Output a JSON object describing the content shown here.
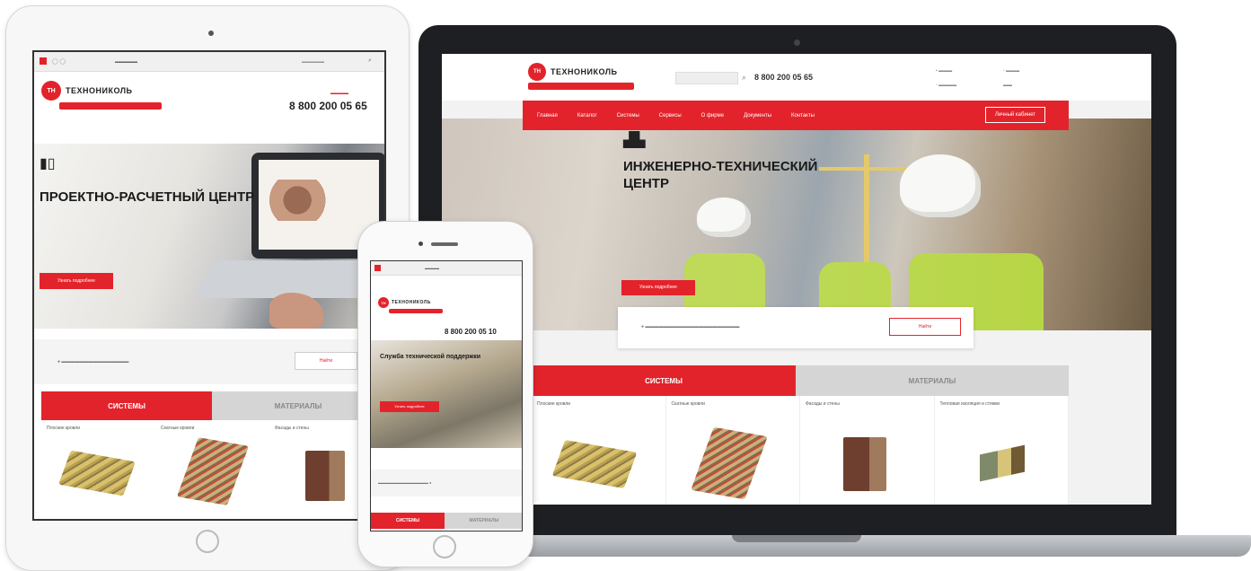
{
  "brand": {
    "name": "ТЕХНОНИКОЛЬ",
    "logo_mark": "ТН",
    "accent_color": "#e3232b"
  },
  "laptop": {
    "phone_number": "8 800 200 05 65",
    "nav": [
      "Главная",
      "Каталог",
      "Системы",
      "Сервисы",
      "О фирме",
      "Документы",
      "Контакты"
    ],
    "nav_cta": "Личный кабинет",
    "hero_icon": "engineering-icon",
    "hero_title": "ИНЖЕНЕРНО-ТЕХНИЧЕСКИЙ ЦЕНТР",
    "hero_button": "Узнать подробнее",
    "filter_button": "Найти",
    "tabs": {
      "active": "СИСТЕМЫ",
      "inactive": "МАТЕРИАЛЫ"
    },
    "cards": [
      {
        "label": "Плоские кровли"
      },
      {
        "label": "Скатные кровли"
      },
      {
        "label": "Фасады и стены"
      },
      {
        "label": "Тепловая изоляция и стяжки"
      }
    ]
  },
  "tablet": {
    "phone_number": "8 800 200 05 65",
    "hero_icon": "calculator-icon",
    "hero_title": "ПРОЕКТНО-РАСЧЕТНЫЙ ЦЕНТР",
    "hero_button": "Узнать подробнее",
    "filter_button": "Найти",
    "tabs": {
      "active": "СИСТЕМЫ",
      "inactive": "МАТЕРИАЛЫ"
    },
    "cards": [
      {
        "label": "Плоские кровли"
      },
      {
        "label": "Скатные кровли"
      },
      {
        "label": "Фасады и стены"
      }
    ]
  },
  "phone": {
    "phone_number": "8 800 200 05 10",
    "hero_title": "Служба технической поддержки",
    "hero_button": "Узнать подробнее",
    "tabs": {
      "active": "СИСТЕМЫ",
      "inactive": "МАТЕРИАЛЫ"
    }
  }
}
